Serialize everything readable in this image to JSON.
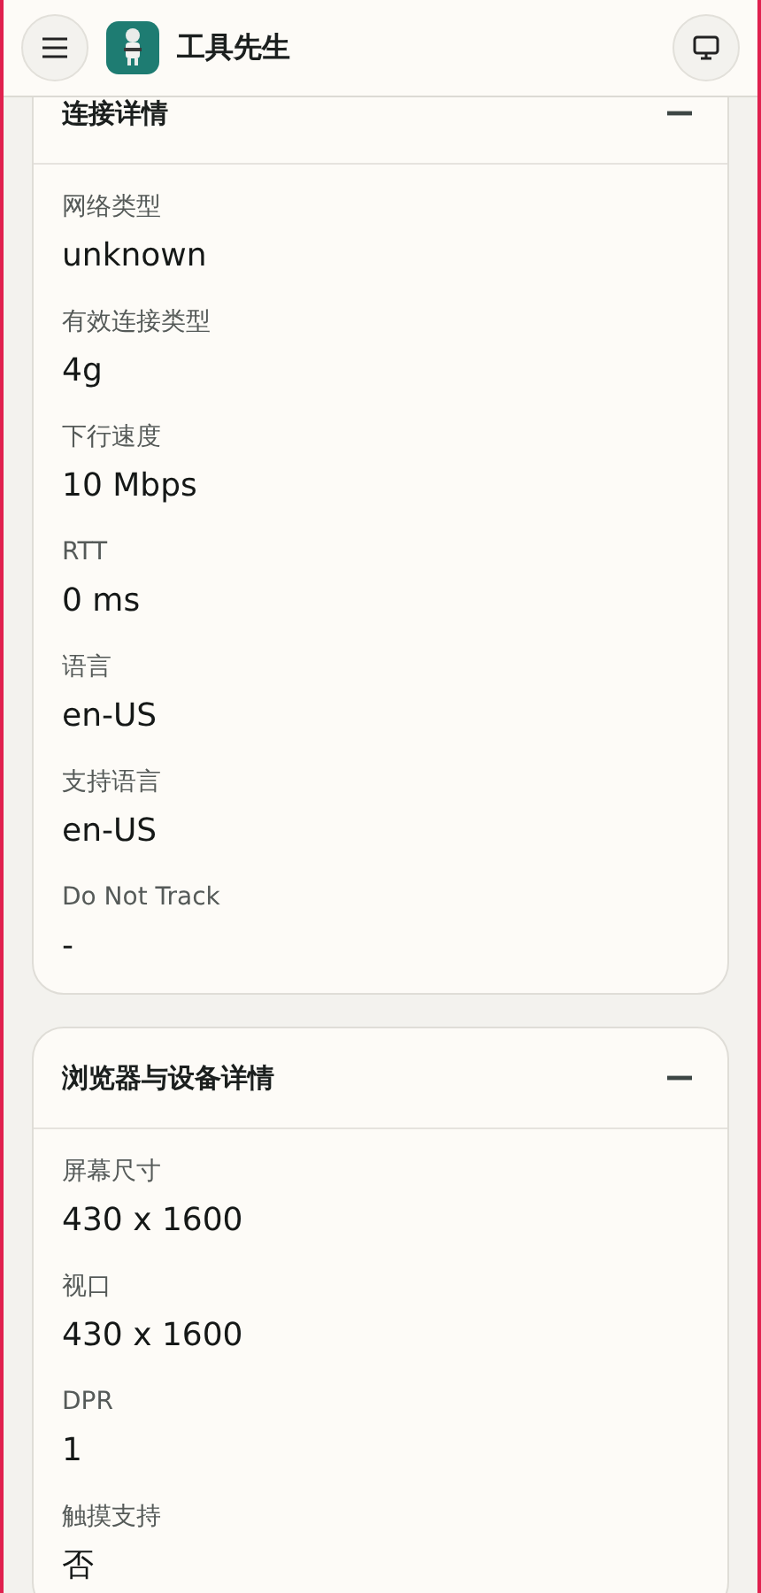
{
  "header": {
    "title": "工具先生"
  },
  "sections": [
    {
      "title": "连接详情",
      "expanded": true,
      "fields": [
        {
          "label": "网络类型",
          "value": "unknown"
        },
        {
          "label": "有效连接类型",
          "value": "4g"
        },
        {
          "label": "下行速度",
          "value": "10 Mbps"
        },
        {
          "label": "RTT",
          "value": "0 ms"
        },
        {
          "label": "语言",
          "value": "en-US"
        },
        {
          "label": "支持语言",
          "value": "en-US"
        },
        {
          "label": "Do Not Track",
          "value": "-"
        }
      ]
    },
    {
      "title": "浏览器与设备详情",
      "expanded": true,
      "fields": [
        {
          "label": "屏幕尺寸",
          "value": "430 x 1600"
        },
        {
          "label": "视口",
          "value": "430 x 1600"
        },
        {
          "label": "DPR",
          "value": "1"
        },
        {
          "label": "触摸支持",
          "value": "否"
        }
      ]
    }
  ]
}
